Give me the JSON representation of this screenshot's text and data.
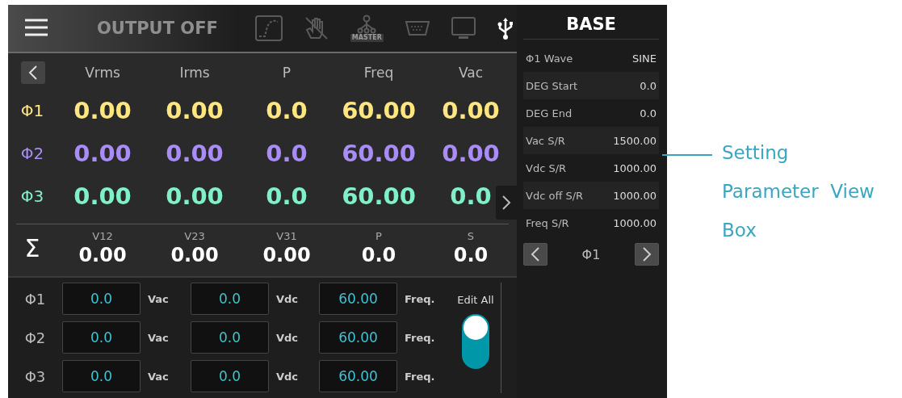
{
  "top_bar": {
    "status": "OUTPUT OFF",
    "icons": [
      {
        "kind": "waveform",
        "active": false
      },
      {
        "kind": "hand",
        "active": false
      },
      {
        "kind": "master",
        "label": "MASTER",
        "active": false
      },
      {
        "kind": "serial",
        "active": false
      },
      {
        "kind": "monitor",
        "active": false
      },
      {
        "kind": "usb",
        "active": true
      }
    ]
  },
  "measurements": {
    "columns": [
      "Vrms",
      "Irms",
      "P",
      "Freq",
      "Vac"
    ],
    "rows": [
      {
        "phase": "Φ1",
        "color": "#ffe680",
        "values": [
          "0.00",
          "0.00",
          "0.0",
          "60.00",
          "0.00"
        ]
      },
      {
        "phase": "Φ2",
        "color": "#a98cf5",
        "values": [
          "0.00",
          "0.00",
          "0.0",
          "60.00",
          "0.00"
        ]
      },
      {
        "phase": "Φ3",
        "color": "#80f0c8",
        "values": [
          "0.00",
          "0.00",
          "0.0",
          "60.00",
          "0.0"
        ]
      }
    ]
  },
  "totals": {
    "symbol": "Σ",
    "columns": [
      "V12",
      "V23",
      "V31",
      "P",
      "S"
    ],
    "values": [
      "0.00",
      "0.00",
      "0.00",
      "0.0",
      "0.0"
    ]
  },
  "settings": {
    "rows": [
      {
        "phase": "Φ1",
        "fields": [
          {
            "value": "0.0",
            "unit": "Vac"
          },
          {
            "value": "0.0",
            "unit": "Vdc"
          },
          {
            "value": "60.00",
            "unit": "Freq."
          }
        ]
      },
      {
        "phase": "Φ2",
        "fields": [
          {
            "value": "0.0",
            "unit": "Vac"
          },
          {
            "value": "0.0",
            "unit": "Vdc"
          },
          {
            "value": "60.00",
            "unit": "Freq."
          }
        ]
      },
      {
        "phase": "Φ3",
        "fields": [
          {
            "value": "0.0",
            "unit": "Vac"
          },
          {
            "value": "0.0",
            "unit": "Vdc"
          },
          {
            "value": "60.00",
            "unit": "Freq."
          }
        ]
      }
    ],
    "edit_all": {
      "label": "Edit All",
      "on": true
    }
  },
  "side_panel": {
    "title": "BASE",
    "rows": [
      {
        "label": "Φ1 Wave",
        "value": "SINE"
      },
      {
        "label": "DEG Start",
        "value": "0.0"
      },
      {
        "label": "DEG End",
        "value": "0.0"
      },
      {
        "label": "Vac S/R",
        "value": "1500.00"
      },
      {
        "label": "Vdc S/R",
        "value": "1000.00"
      },
      {
        "label": "Vdc off S/R",
        "value": "1000.00"
      },
      {
        "label": "Freq S/R",
        "value": "1000.00"
      }
    ],
    "phase": "Φ1"
  },
  "annotation": {
    "lines": [
      "Setting",
      "Parameter  View",
      "Box"
    ]
  }
}
